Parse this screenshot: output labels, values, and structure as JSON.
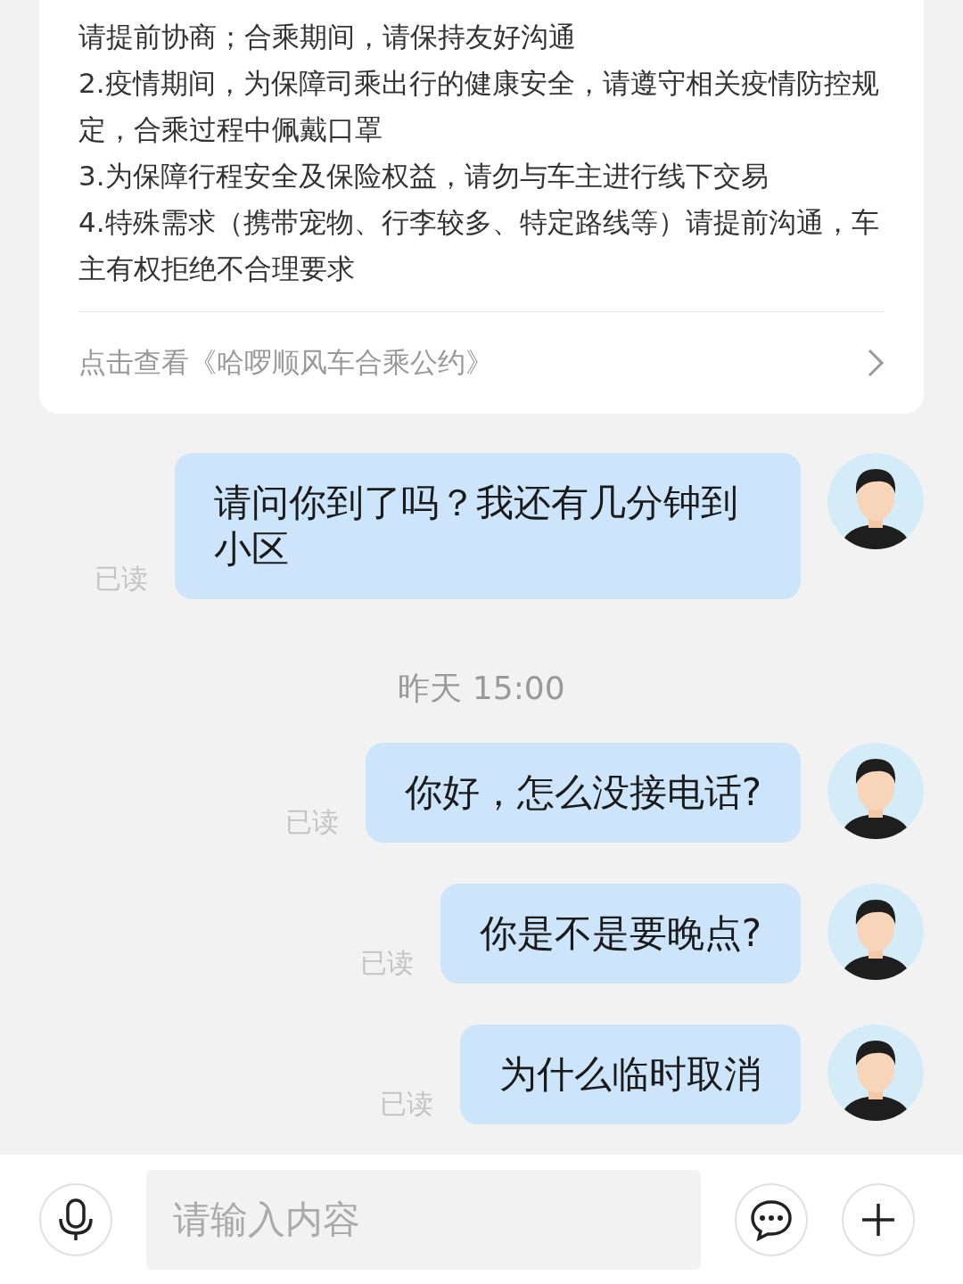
{
  "notice_card": {
    "paragraphs": [
      "请提前协商；合乘期间，请保持友好沟通",
      "2.疫情期间，为保障司乘出行的健康安全，请遵守相关疫情防控规定，合乘过程中佩戴口罩",
      "3.为保障行程安全及保险权益，请勿与车主进行线下交易",
      "4.特殊需求（携带宠物、行李较多、特定路线等）请提前沟通，车主有权拒绝不合理要求"
    ],
    "link": "点击查看《哈啰顺风车合乘公约》"
  },
  "messages": [
    {
      "kind": "message",
      "text": "请问你到了吗？我还有几分钟到小区",
      "status": "已读"
    },
    {
      "kind": "time",
      "text": "昨天 15:00"
    },
    {
      "kind": "message",
      "text": "你好，怎么没接电话?",
      "status": "已读"
    },
    {
      "kind": "message",
      "text": "你是不是要晚点?",
      "status": "已读"
    },
    {
      "kind": "message",
      "text": "为什么临时取消",
      "status": "已读"
    }
  ],
  "input_bar": {
    "placeholder": "请输入内容"
  }
}
